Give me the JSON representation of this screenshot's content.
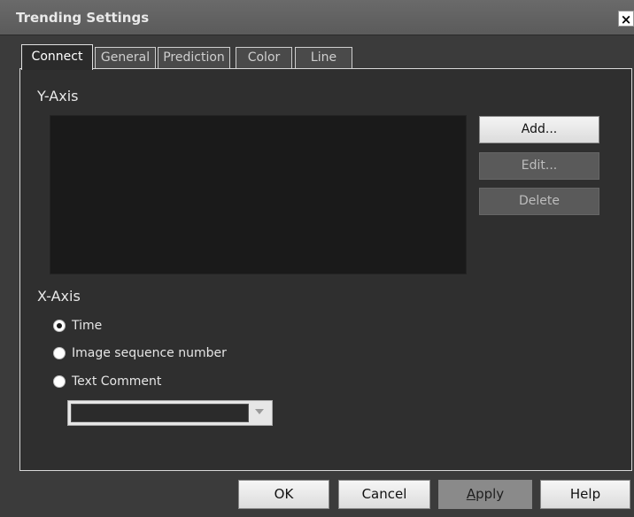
{
  "window": {
    "title": "Trending Settings",
    "close_glyph": "×"
  },
  "tabs": [
    {
      "label": "Connect",
      "active": true
    },
    {
      "label": "General"
    },
    {
      "label": "Prediction"
    },
    {
      "label": "Color"
    },
    {
      "label": "Line"
    }
  ],
  "y_axis": {
    "label": "Y-Axis",
    "buttons": {
      "add": "Add...",
      "edit": "Edit...",
      "delete": "Delete"
    }
  },
  "x_axis": {
    "label": "X-Axis",
    "options": [
      {
        "label": "Time",
        "checked": true
      },
      {
        "label": "Image sequence number",
        "checked": false
      },
      {
        "label": "Text Comment",
        "checked": false
      }
    ],
    "comment_select_value": ""
  },
  "footer": {
    "ok": "OK",
    "cancel": "Cancel",
    "apply_first": "A",
    "apply_rest": "pply",
    "help": "Help"
  }
}
